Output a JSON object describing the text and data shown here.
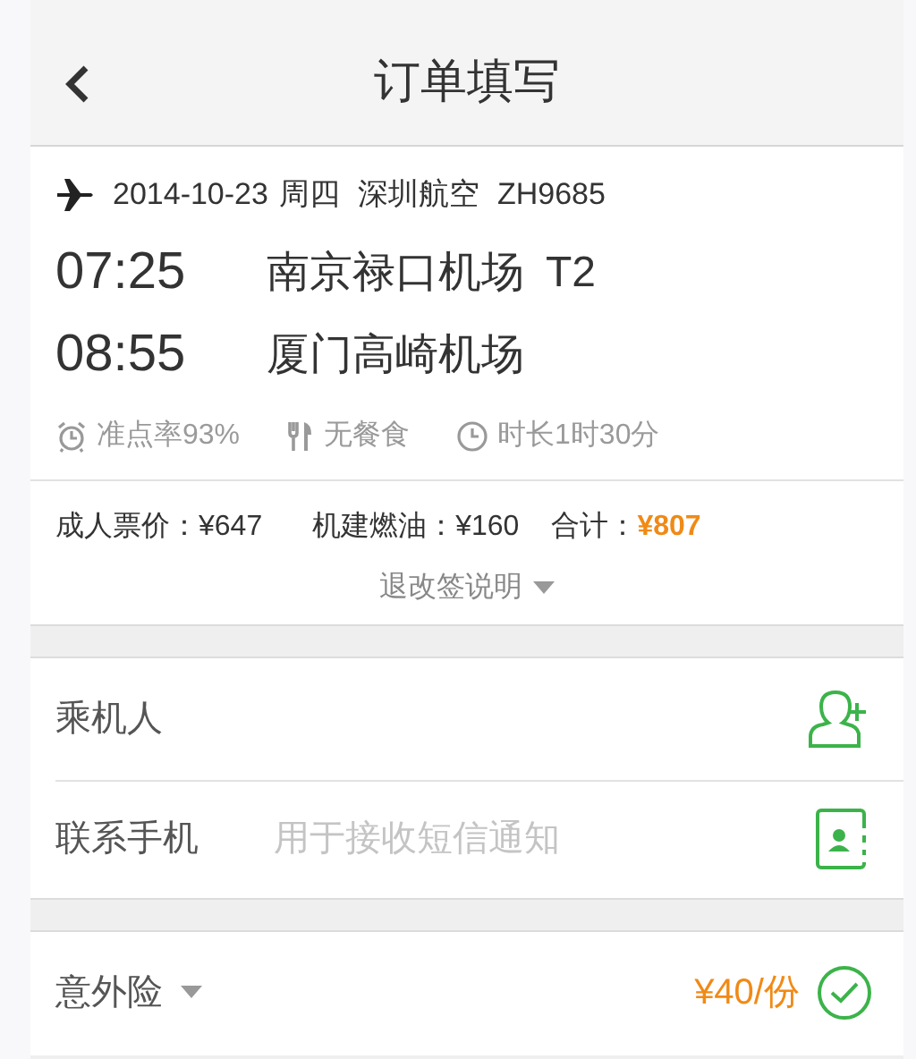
{
  "header": {
    "title": "订单填写"
  },
  "flight": {
    "date": "2014-10-23",
    "weekday": "周四",
    "airline": "深圳航空",
    "flight_no": "ZH9685",
    "segments": [
      {
        "time": "07:25",
        "airport": "南京禄口机场",
        "terminal": "T2"
      },
      {
        "time": "08:55",
        "airport": "厦门高崎机场"
      }
    ],
    "facts": [
      {
        "kind": "punctuality",
        "text": "准点率93%"
      },
      {
        "kind": "meal",
        "text": "无餐食"
      },
      {
        "kind": "duration",
        "text": "时长1时30分"
      }
    ]
  },
  "price": {
    "items": [
      {
        "kind": "plain",
        "label": "成人票价：",
        "value": "¥647"
      },
      {
        "kind": "plain",
        "label": "机建燃油：",
        "value": "¥160"
      },
      {
        "kind": "total",
        "label": "合计：",
        "value": "¥807"
      }
    ],
    "policy_link": "退改签说明"
  },
  "passenger": {
    "label": "乘机人"
  },
  "contact": {
    "label": "联系手机",
    "placeholder": "用于接收短信通知"
  },
  "insurance": {
    "label": "意外险",
    "price": "¥40/份",
    "checked": true
  }
}
